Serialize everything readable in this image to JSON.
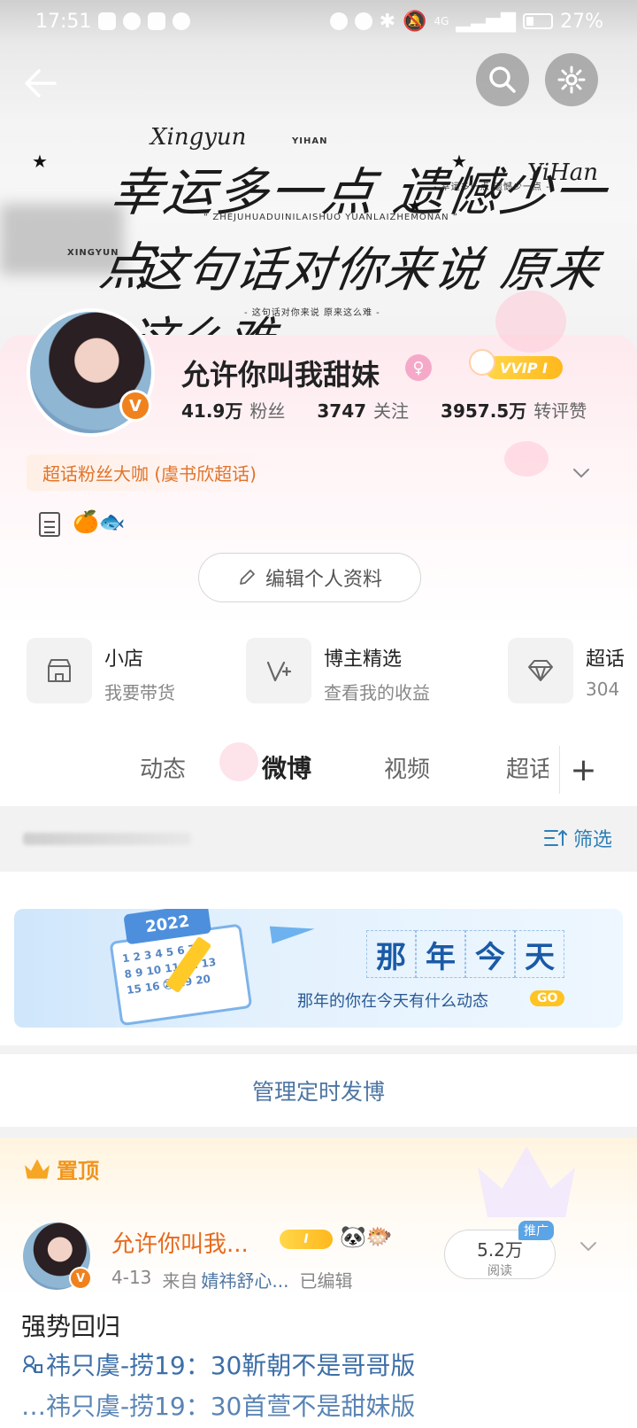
{
  "status_bar": {
    "time": "17:51",
    "network": "4G",
    "battery": "27%"
  },
  "banner": {
    "line1": "幸运多一点 遗憾少一点",
    "line2": "这句话对你来说 原来这么难",
    "tag_top": "YIHAN",
    "tag_left": "XINGYUN",
    "pinyin": "“ ZHEJUHUADUINILAISHUO YUANLAIZHEMONAN ”",
    "caption_right": "- 幸运多一点 遗憾少一点 -",
    "caption_bottom": "- 这句话对你来说 原来这么难 -",
    "script_left": "Xingyun",
    "script_right": "YiHan"
  },
  "profile": {
    "name": "允许你叫我甜妹",
    "vip_label": "VVIP I",
    "badge_letter": "V",
    "fans_count": "41.9万",
    "fans_label": "粉丝",
    "following_count": "3747",
    "following_label": "关注",
    "likes_count": "3957.5万",
    "likes_label": "转评赞",
    "chaohua_tag": "超话粉丝大咖 (虞书欣超话)",
    "desc_emoji": "🍊🐟",
    "edit_label": "编辑个人资料"
  },
  "shortcuts": [
    {
      "title": "小店",
      "sub": "我要带货",
      "icon": "shop-icon"
    },
    {
      "title": "博主精选",
      "sub": "查看我的收益",
      "icon": "v-plus-icon"
    },
    {
      "title": "超话",
      "sub": "304",
      "icon": "diamond-icon"
    }
  ],
  "tabs": {
    "items": [
      "动态",
      "微博",
      "视频",
      "超话"
    ],
    "active": "微博"
  },
  "filter": {
    "label": "筛选"
  },
  "memory": {
    "chars": [
      "那",
      "年",
      "今",
      "天"
    ],
    "subtitle": "那年的你在今天有什么动态",
    "go": "GO",
    "calendar_year": "2022",
    "calendar_nums": "1 2 3 4 5 6 7\n8 9 10 11 12 13\n15 16 ㉖ 19 20"
  },
  "timed_post": {
    "label": "管理定时发博"
  },
  "pinned": {
    "label": "置顶",
    "name": "允许你叫我...",
    "vip": "I",
    "emoji": "🐼🐡",
    "date": "4-13",
    "from_label": "来自",
    "source": "婧祎舒心...",
    "edited": "已编辑",
    "read_count": "5.2万",
    "read_label": "阅读",
    "promo": "推广",
    "text": "强势回归",
    "topic": "祎只虞-捞19：30靳朝不是哥哥版",
    "topic_line2": "…祎只虞-捞19：30首萱不是甜妹版"
  }
}
